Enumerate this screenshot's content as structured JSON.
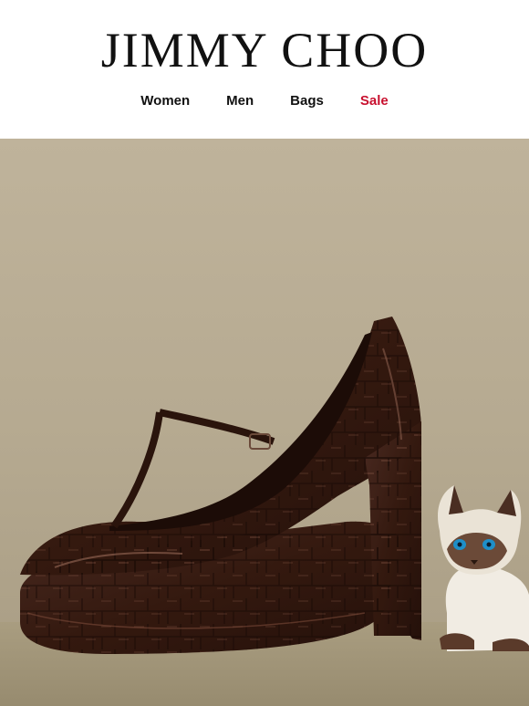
{
  "brand": {
    "name": "JIMMY CHOO"
  },
  "nav": {
    "items": [
      {
        "label": "Women"
      },
      {
        "label": "Men"
      },
      {
        "label": "Bags"
      },
      {
        "label": "Sale"
      }
    ]
  },
  "colors": {
    "sale": "#c8102e",
    "text": "#111111",
    "background": "#ffffff",
    "shoe": "#3a1f18",
    "wall": "#b7ab93"
  },
  "hero": {
    "image": "brown-croc-platform-mary-jane-heel-with-siamese-cat-figurine"
  }
}
